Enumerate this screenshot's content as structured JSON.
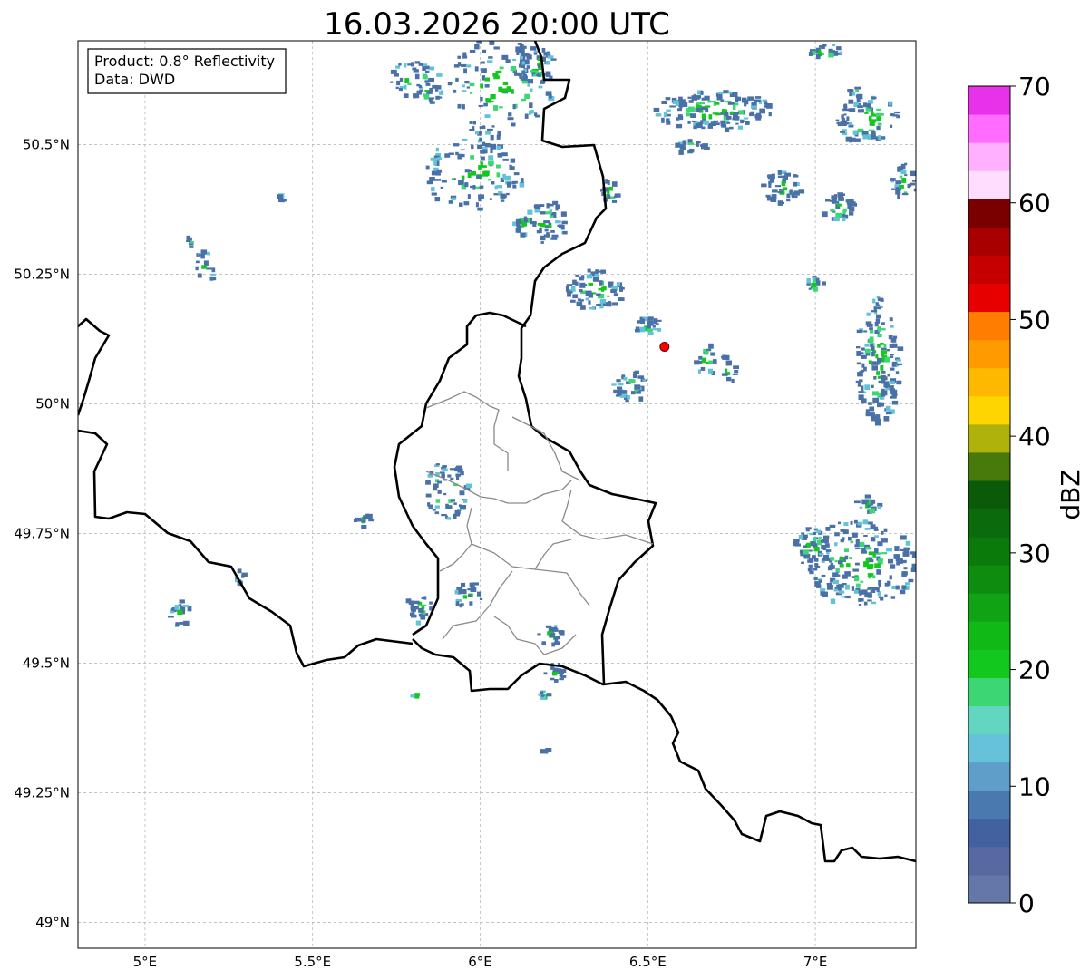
{
  "title": "16.03.2026 20:00 UTC",
  "info_box": {
    "line1": "Product: 0.8° Reflectivity",
    "line2": "Data: DWD"
  },
  "axes": {
    "lon_ticks": [
      {
        "value": 5.0,
        "label": "5°E"
      },
      {
        "value": 5.5,
        "label": "5.5°E"
      },
      {
        "value": 6.0,
        "label": "6°E"
      },
      {
        "value": 6.5,
        "label": "6.5°E"
      },
      {
        "value": 7.0,
        "label": "7°E"
      }
    ],
    "lat_ticks": [
      {
        "value": 49.0,
        "label": "49°N"
      },
      {
        "value": 49.25,
        "label": "49.25°N"
      },
      {
        "value": 49.5,
        "label": "49.5°N"
      },
      {
        "value": 49.75,
        "label": "49.75°N"
      },
      {
        "value": 50.0,
        "label": "50°N"
      },
      {
        "value": 50.25,
        "label": "50.25°N"
      },
      {
        "value": 50.5,
        "label": "50.5°N"
      }
    ],
    "lon_range": [
      4.8,
      7.3
    ],
    "lat_range": [
      48.95,
      50.7
    ],
    "grid": true
  },
  "colorbar": {
    "label": "dBZ",
    "range": [
      0,
      70
    ],
    "ticks": [
      "0",
      "10",
      "20",
      "30",
      "40",
      "50",
      "60",
      "70"
    ],
    "colors": [
      "#6577a8",
      "#5769a0",
      "#43609f",
      "#4a79b0",
      "#5e9ec8",
      "#66c2db",
      "#63d6c2",
      "#3cd674",
      "#12c71d",
      "#10b915",
      "#10a414",
      "#0e8c10",
      "#0a7a0b",
      "#0b6a0b",
      "#0a5a0a",
      "#477a0b",
      "#afb20a",
      "#ffd500",
      "#ffb800",
      "#ff9a00",
      "#ff7d00",
      "#e60000",
      "#c60000",
      "#a80000",
      "#7a0000",
      "#ffddff",
      "#ffb0ff",
      "#ff6cff",
      "#e832ea"
    ]
  },
  "radar_site": {
    "lon": 6.55,
    "lat": 50.11,
    "color": "#ff0000"
  },
  "echo_colors": {
    "weak": "#4a70a8",
    "light": "#63c3d6",
    "moderate": "#3cd674",
    "strong": "#12c71d"
  }
}
